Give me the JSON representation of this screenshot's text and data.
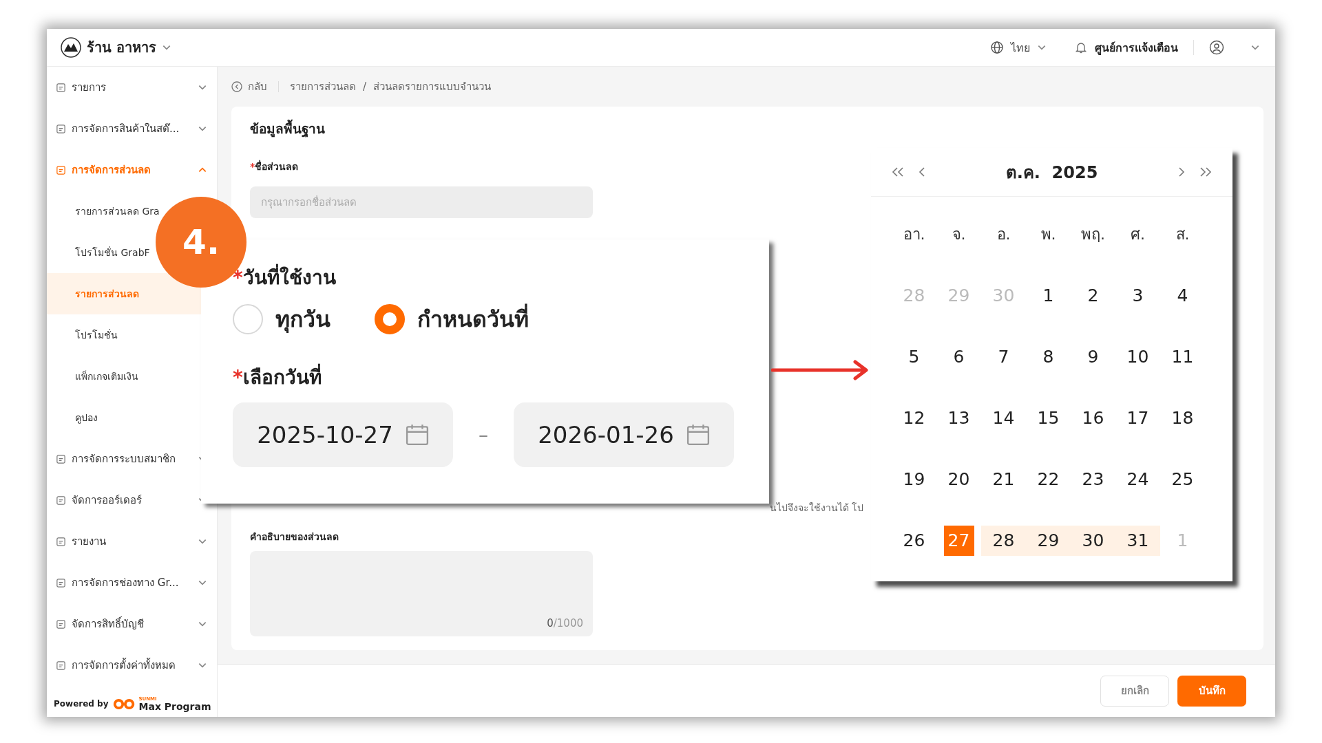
{
  "topbar": {
    "store_name": "ร้าน อาหาร",
    "language": "ไทย",
    "notifications": "ศูนย์การแจ้งเตือน"
  },
  "sidebar": {
    "items": [
      {
        "label": "รายการ",
        "selected": false,
        "expanded": false
      },
      {
        "label": "การจัดการสินค้าในสต๊...",
        "selected": false,
        "expanded": false
      },
      {
        "label": "การจัดการส่วนลด",
        "selected": true,
        "expanded": true,
        "children": [
          {
            "label": "รายการส่วนลด Gra",
            "selected": false
          },
          {
            "label": "โปรโมชั่น GrabF",
            "selected": false
          },
          {
            "label": "รายการส่วนลด",
            "selected": true
          },
          {
            "label": "โปรโมชั่น",
            "selected": false
          },
          {
            "label": "แพ็กเกจเติมเงิน",
            "selected": false
          },
          {
            "label": "คูปอง",
            "selected": false
          }
        ]
      },
      {
        "label": "การจัดการระบบสมาชิก",
        "selected": false,
        "expanded": false
      },
      {
        "label": "จัดการออร์เดอร์",
        "selected": false,
        "expanded": false
      },
      {
        "label": "รายงาน",
        "selected": false,
        "expanded": false
      },
      {
        "label": "การจัดการช่องทาง Gr...",
        "selected": false,
        "expanded": false
      },
      {
        "label": "จัดการสิทธิ์บัญชี",
        "selected": false,
        "expanded": false
      },
      {
        "label": "การจัดการตั้งค่าทั้งหมด",
        "selected": false,
        "expanded": false
      }
    ],
    "powered_by": "Powered by",
    "brand_small": "SUNMI",
    "brand": "Max Program"
  },
  "breadcrumb": {
    "back": "กลับ",
    "items": [
      "รายการส่วนลด",
      "ส่วนลดรายการแบบจำนวน"
    ],
    "separator": "/"
  },
  "form": {
    "section_title": "ข้อมูลพื้นฐาน",
    "required_mark": "*",
    "name_label": "ชื่อส่วนลด",
    "name_placeholder": "กรุณากรอกชื่อส่วนลด",
    "hint": "นไปจึงจะใช้งานได้ โป",
    "description_label": "คำอธิบายของส่วนลด",
    "counter_count": "0",
    "counter_max": "/1000"
  },
  "footer": {
    "buttons": [
      {
        "label": "ยกเลิก",
        "kind": "secondary"
      },
      {
        "label": "บันทึก",
        "kind": "primary"
      }
    ]
  },
  "callout": {
    "step": "4.",
    "required_mark": "*",
    "usage_label": "วันที่ใช้งาน",
    "radios": [
      {
        "label": "ทุกวัน",
        "selected": false
      },
      {
        "label": "กำหนดวันที่",
        "selected": true
      }
    ],
    "date_label": "เลือกวันที่",
    "start_date": "2025-10-27",
    "separator": "–",
    "end_date": "2026-01-26"
  },
  "calendar": {
    "title": "ต.ค.  2025",
    "weekdays": [
      "อา.",
      "จ.",
      "อ.",
      "พ.",
      "พฤ.",
      "ศ.",
      "ส."
    ],
    "days": [
      {
        "label": "28",
        "muted": true,
        "selected": false,
        "in_range": false
      },
      {
        "label": "29",
        "muted": true,
        "selected": false,
        "in_range": false
      },
      {
        "label": "30",
        "muted": true,
        "selected": false,
        "in_range": false
      },
      {
        "label": "1",
        "muted": false,
        "selected": false,
        "in_range": false
      },
      {
        "label": "2",
        "muted": false,
        "selected": false,
        "in_range": false
      },
      {
        "label": "3",
        "muted": false,
        "selected": false,
        "in_range": false
      },
      {
        "label": "4",
        "muted": false,
        "selected": false,
        "in_range": false
      },
      {
        "label": "5",
        "muted": false,
        "selected": false,
        "in_range": false
      },
      {
        "label": "6",
        "muted": false,
        "selected": false,
        "in_range": false
      },
      {
        "label": "7",
        "muted": false,
        "selected": false,
        "in_range": false
      },
      {
        "label": "8",
        "muted": false,
        "selected": false,
        "in_range": false
      },
      {
        "label": "9",
        "muted": false,
        "selected": false,
        "in_range": false
      },
      {
        "label": "10",
        "muted": false,
        "selected": false,
        "in_range": false
      },
      {
        "label": "11",
        "muted": false,
        "selected": false,
        "in_range": false
      },
      {
        "label": "12",
        "muted": false,
        "selected": false,
        "in_range": false
      },
      {
        "label": "13",
        "muted": false,
        "selected": false,
        "in_range": false
      },
      {
        "label": "14",
        "muted": false,
        "selected": false,
        "in_range": false
      },
      {
        "label": "15",
        "muted": false,
        "selected": false,
        "in_range": false
      },
      {
        "label": "16",
        "muted": false,
        "selected": false,
        "in_range": false
      },
      {
        "label": "17",
        "muted": false,
        "selected": false,
        "in_range": false
      },
      {
        "label": "18",
        "muted": false,
        "selected": false,
        "in_range": false
      },
      {
        "label": "19",
        "muted": false,
        "selected": false,
        "in_range": false
      },
      {
        "label": "20",
        "muted": false,
        "selected": false,
        "in_range": false
      },
      {
        "label": "21",
        "muted": false,
        "selected": false,
        "in_range": false
      },
      {
        "label": "22",
        "muted": false,
        "selected": false,
        "in_range": false
      },
      {
        "label": "23",
        "muted": false,
        "selected": false,
        "in_range": false
      },
      {
        "label": "24",
        "muted": false,
        "selected": false,
        "in_range": false
      },
      {
        "label": "25",
        "muted": false,
        "selected": false,
        "in_range": false
      },
      {
        "label": "26",
        "muted": false,
        "selected": false,
        "in_range": false
      },
      {
        "label": "27",
        "muted": false,
        "selected": true,
        "in_range": false
      },
      {
        "label": "28",
        "muted": false,
        "selected": false,
        "in_range": true
      },
      {
        "label": "29",
        "muted": false,
        "selected": false,
        "in_range": true
      },
      {
        "label": "30",
        "muted": false,
        "selected": false,
        "in_range": true
      },
      {
        "label": "31",
        "muted": false,
        "selected": false,
        "in_range": true
      },
      {
        "label": "1",
        "muted": true,
        "selected": false,
        "in_range": false
      }
    ]
  }
}
